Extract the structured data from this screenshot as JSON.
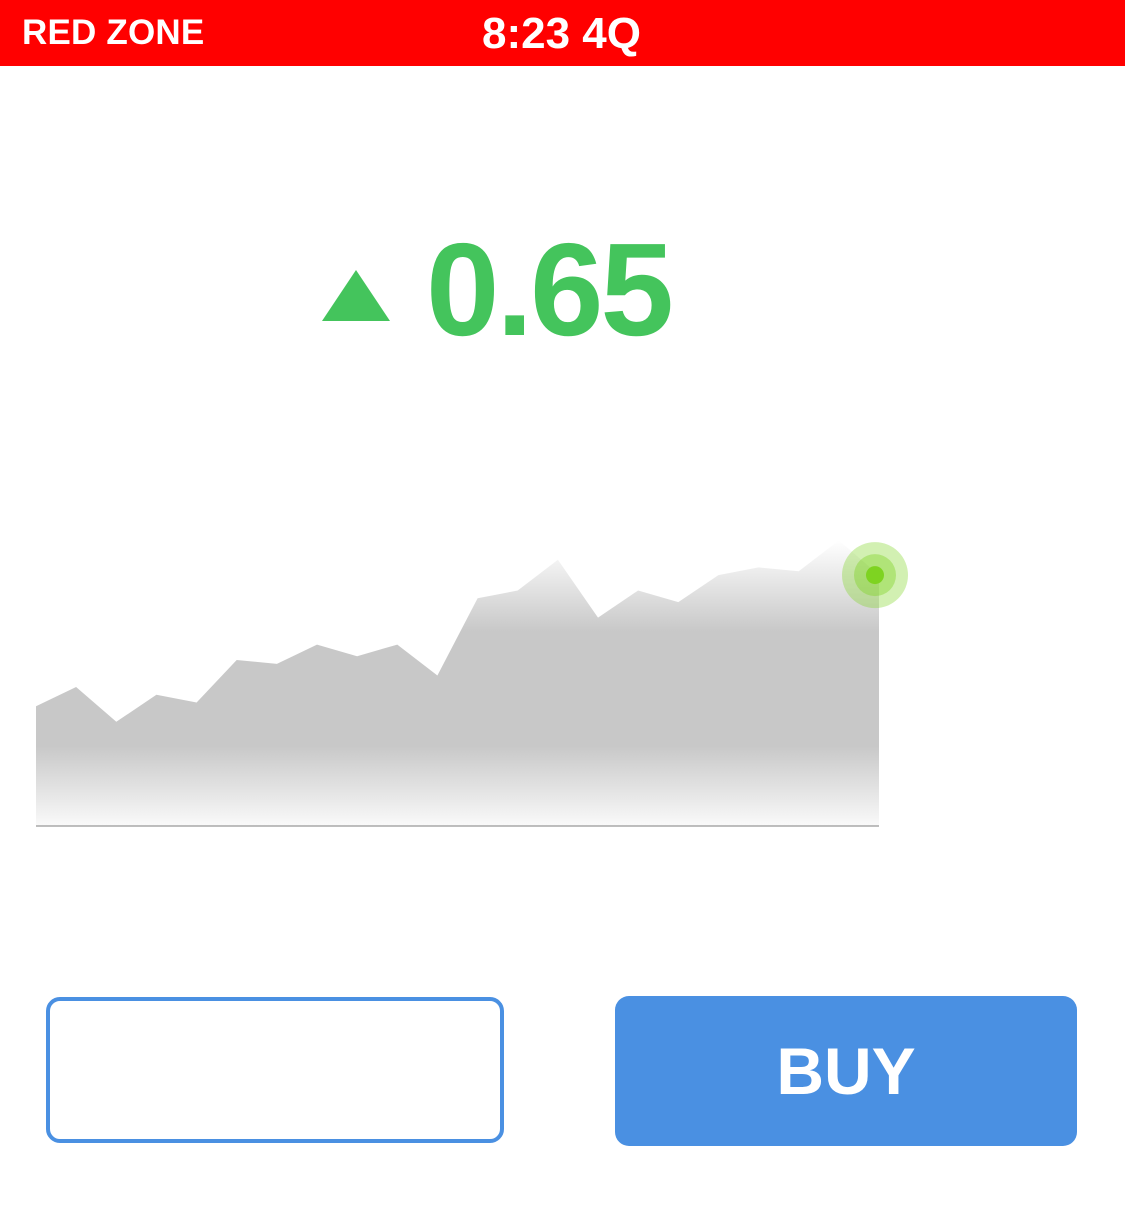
{
  "status_bar": {
    "zone": "RED ZONE",
    "clock": "8:23 4Q",
    "background_color": "#ff0000",
    "text_color": "#ffffff"
  },
  "price_change": {
    "direction": "up",
    "icon": "up-arrow-icon",
    "value": "0.65",
    "color": "#44c45c"
  },
  "chart_data": {
    "type": "area",
    "title": "",
    "xlabel": "",
    "ylabel": "",
    "grid": "dashed horizontal lines",
    "legend": "none",
    "x": [
      0,
      1,
      2,
      3,
      4,
      5,
      6,
      7,
      8,
      9,
      10,
      11,
      12,
      13,
      14,
      15,
      16,
      17,
      18,
      19,
      20,
      21
    ],
    "values": [
      0.31,
      0.36,
      0.27,
      0.34,
      0.32,
      0.43,
      0.42,
      0.47,
      0.44,
      0.47,
      0.39,
      0.59,
      0.61,
      0.69,
      0.54,
      0.61,
      0.58,
      0.65,
      0.67,
      0.66,
      0.74,
      0.65
    ],
    "xlim": [
      0,
      21
    ],
    "ylim": [
      0,
      1
    ],
    "fill_color": "#c8c8c8",
    "marker_color": "#7ed321"
  },
  "order": {
    "amount_placeholder": "",
    "buy_label": "BUY",
    "accent_color": "#4a90e2"
  }
}
